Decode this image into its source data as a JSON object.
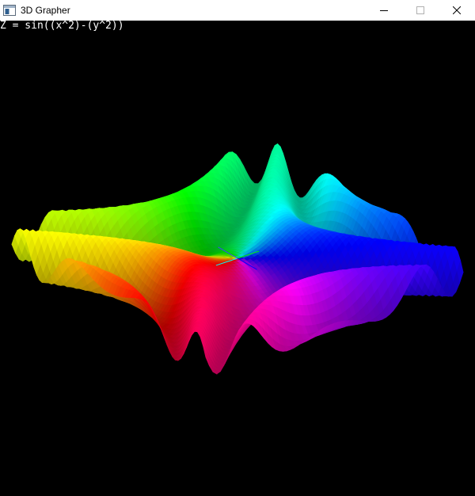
{
  "window": {
    "title": "3D Grapher",
    "icon": "app-window-icon",
    "controls": {
      "minimize_icon": "minimize-icon",
      "maximize_icon": "maximize-icon",
      "close_icon": "close-icon"
    }
  },
  "graph": {
    "equation": "Z = sin((x^2)-(y^2))",
    "background_color": "#000000",
    "text_color": "#ffffff",
    "coloring": "rainbow-by-height",
    "palette": [
      "#ff0000",
      "#ff00ff",
      "#0000ff",
      "#00ffff",
      "#00ff00",
      "#ffff00",
      "#ff0000"
    ]
  }
}
